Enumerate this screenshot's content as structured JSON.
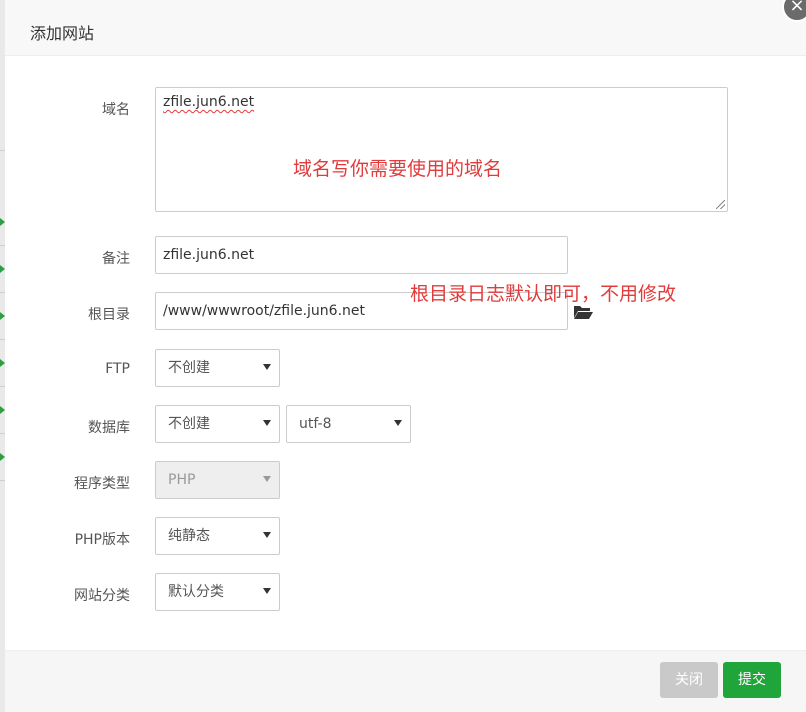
{
  "dialog": {
    "title": "添加网站",
    "close_glyph": "×"
  },
  "form": {
    "domain": {
      "label": "域名",
      "value": "zfile.jun6.net"
    },
    "remark": {
      "label": "备注",
      "value": "zfile.jun6.net"
    },
    "root_dir": {
      "label": "根目录",
      "value": "/www/wwwroot/zfile.jun6.net",
      "icon": "folder-open-icon"
    },
    "ftp": {
      "label": "FTP",
      "selected": "不创建"
    },
    "database": {
      "label": "数据库",
      "selected": "不创建",
      "charset_selected": "utf-8"
    },
    "program_type": {
      "label": "程序类型",
      "selected": "PHP"
    },
    "php_version": {
      "label": "PHP版本",
      "selected": "纯静态"
    },
    "site_category": {
      "label": "网站分类",
      "selected": "默认分类"
    }
  },
  "annotations": {
    "domain_note": "域名写你需要使用的域名",
    "root_note": "根目录日志默认即可，不用修改"
  },
  "footer": {
    "close_label": "关闭",
    "submit_label": "提交"
  },
  "colors": {
    "primary_green": "#20a53a",
    "annotation_red": "#e23b3b",
    "disabled_gray": "#c9c9c9"
  }
}
